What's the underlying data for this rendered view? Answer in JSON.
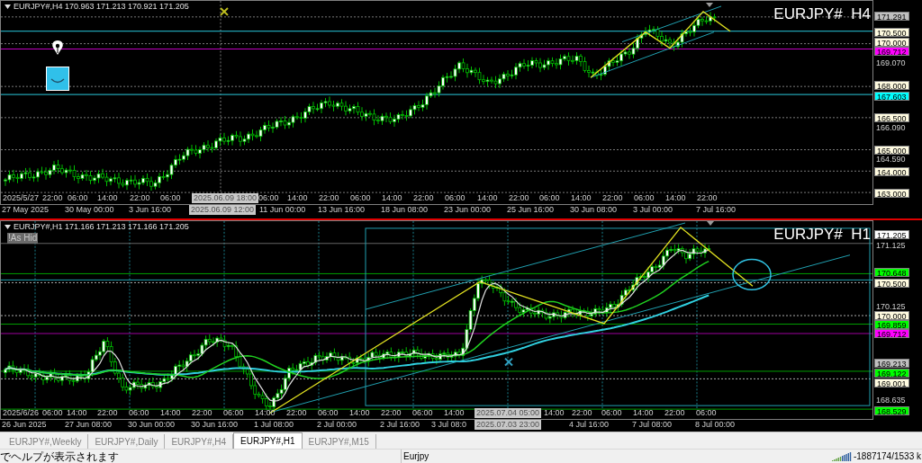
{
  "panels": [
    {
      "kind": "h4",
      "header": "EURJPY#,H4 170.963 171.213 170.921 171.205",
      "title": "EURJPY#  H4",
      "price_labels": [
        {
          "text": "171.291",
          "kind": "tag",
          "color": "#c0c0c0"
        },
        {
          "text": "170.500",
          "kind": "tag",
          "color": "#fffbe0"
        },
        {
          "text": "170.000",
          "kind": "tag",
          "color": "#fffbe0"
        },
        {
          "text": "169.712",
          "kind": "tag",
          "color": "#ff00ff"
        },
        {
          "text": "169.070",
          "kind": "plain"
        },
        {
          "text": "168.000",
          "kind": "tag",
          "color": "#fffbe0"
        },
        {
          "text": "167.603",
          "kind": "tag",
          "color": "#00ffff"
        },
        {
          "text": "166.500",
          "kind": "tag",
          "color": "#fffbe0"
        },
        {
          "text": "166.090",
          "kind": "plain"
        },
        {
          "text": "165.000",
          "kind": "tag",
          "color": "#fffbe0"
        },
        {
          "text": "164.590",
          "kind": "plain"
        },
        {
          "text": "164.000",
          "kind": "tag",
          "color": "#fffbe0"
        },
        {
          "text": "163.000",
          "kind": "tag",
          "color": "#fffbe0"
        }
      ],
      "time_row_1": [
        {
          "text": "2025/5/27",
          "highlighted": false
        },
        {
          "text": "22:00",
          "highlighted": false
        },
        {
          "text": "06:00",
          "highlighted": false
        },
        {
          "text": "14:00",
          "highlighted": false
        },
        {
          "text": "22:00",
          "highlighted": false
        },
        {
          "text": "06:00",
          "highlighted": false
        },
        {
          "text": "2025.06.09 18:00",
          "highlighted": true
        },
        {
          "text": "06:00",
          "highlighted": false
        },
        {
          "text": "14:00",
          "highlighted": false
        },
        {
          "text": "22:00",
          "highlighted": false
        },
        {
          "text": "06:00",
          "highlighted": false
        },
        {
          "text": "14:00",
          "highlighted": false
        },
        {
          "text": "22:00",
          "highlighted": false
        },
        {
          "text": "06:00",
          "highlighted": false
        },
        {
          "text": "14:00",
          "highlighted": false
        },
        {
          "text": "22:00",
          "highlighted": false
        },
        {
          "text": "06:00",
          "highlighted": false
        },
        {
          "text": "14:00",
          "highlighted": false
        },
        {
          "text": "22:00",
          "highlighted": false
        },
        {
          "text": "06:00",
          "highlighted": false
        },
        {
          "text": "14:00",
          "highlighted": false
        },
        {
          "text": "22:00",
          "highlighted": false
        }
      ],
      "time_row_2": [
        {
          "text": "27 May 2025",
          "highlighted": false
        },
        {
          "text": "30 May 00:00",
          "highlighted": false
        },
        {
          "text": "3 Jun 16:00",
          "highlighted": false
        },
        {
          "text": "2025.06.09 12:00",
          "highlighted": true
        },
        {
          "text": "11 Jun 00:00",
          "highlighted": false
        },
        {
          "text": "13 Jun 16:00",
          "highlighted": false
        },
        {
          "text": "18 Jun 08:00",
          "highlighted": false
        },
        {
          "text": "23 Jun 00:00",
          "highlighted": false
        },
        {
          "text": "25 Jun 16:00",
          "highlighted": false
        },
        {
          "text": "30 Jun 08:00",
          "highlighted": false
        },
        {
          "text": "3 Jul 00:00",
          "highlighted": false
        },
        {
          "text": "7 Jul 16:00",
          "highlighted": false
        }
      ]
    },
    {
      "kind": "h1",
      "header": "EURJPY#,H1 171.166 171.213 171.166 171.205",
      "title": "EURJPY#  H1",
      "badge": "!As Hid",
      "price_labels": [
        {
          "text": "171.205",
          "kind": "tag",
          "color": "#ffffff"
        },
        {
          "text": "171.125",
          "kind": "plain"
        },
        {
          "text": "170.648",
          "kind": "tag",
          "color": "#00ff00"
        },
        {
          "text": "170.500",
          "kind": "tag",
          "color": "#fffbe0"
        },
        {
          "text": "170.125",
          "kind": "plain"
        },
        {
          "text": "170.000",
          "kind": "tag",
          "color": "#fffbe0"
        },
        {
          "text": "169.859",
          "kind": "tag",
          "color": "#00ff00"
        },
        {
          "text": "169.712",
          "kind": "tag",
          "color": "#ff00ff"
        },
        {
          "text": "169.213",
          "kind": "tag",
          "color": "#c0c0c0"
        },
        {
          "text": "169.122",
          "kind": "tag",
          "color": "#00ff00"
        },
        {
          "text": "169.001",
          "kind": "tag",
          "color": "#fffbe0"
        },
        {
          "text": "168.635",
          "kind": "plain"
        },
        {
          "text": "168.529",
          "kind": "tag",
          "color": "#00ff00"
        }
      ],
      "time_row_1": [
        {
          "text": "2025/6/26",
          "highlighted": false
        },
        {
          "text": "06:00",
          "highlighted": false
        },
        {
          "text": "14:00",
          "highlighted": false
        },
        {
          "text": "22:00",
          "highlighted": false
        },
        {
          "text": "06:00",
          "highlighted": false
        },
        {
          "text": "14:00",
          "highlighted": false
        },
        {
          "text": "22:00",
          "highlighted": false
        },
        {
          "text": "06:00",
          "highlighted": false
        },
        {
          "text": "14:00",
          "highlighted": false
        },
        {
          "text": "22:00",
          "highlighted": false
        },
        {
          "text": "06:00",
          "highlighted": false
        },
        {
          "text": "14:00",
          "highlighted": false
        },
        {
          "text": "22:00",
          "highlighted": false
        },
        {
          "text": "06:00",
          "highlighted": false
        },
        {
          "text": "14:00",
          "highlighted": false
        },
        {
          "text": "2025.07.04 05:00",
          "highlighted": true
        },
        {
          "text": "14:00",
          "highlighted": false
        },
        {
          "text": "22:00",
          "highlighted": false
        },
        {
          "text": "06:00",
          "highlighted": false
        },
        {
          "text": "14:00",
          "highlighted": false
        },
        {
          "text": "22:00",
          "highlighted": false
        },
        {
          "text": "06:00",
          "highlighted": false
        }
      ],
      "time_row_2": [
        {
          "text": "26 Jun 2025",
          "highlighted": false
        },
        {
          "text": "27 Jun 08:00",
          "highlighted": false
        },
        {
          "text": "30 Jun 00:00",
          "highlighted": false
        },
        {
          "text": "30 Jun 16:00",
          "highlighted": false
        },
        {
          "text": "1 Jul 08:00",
          "highlighted": false
        },
        {
          "text": "2 Jul 00:00",
          "highlighted": false
        },
        {
          "text": "2 Jul 16:00",
          "highlighted": false
        },
        {
          "text": "3 Jul 08:0",
          "highlighted": false
        },
        {
          "text": "2025.07.03 23:00",
          "highlighted": true
        },
        {
          "text": "4 Jul 16:00",
          "highlighted": false
        },
        {
          "text": "7 Jul 08:00",
          "highlighted": false
        },
        {
          "text": "8 Jul 00:00",
          "highlighted": false
        }
      ]
    }
  ],
  "tabs": [
    {
      "label": "EURJPY#,Weekly",
      "selected": false
    },
    {
      "label": "EURJPY#,Daily",
      "selected": false
    },
    {
      "label": "EURJPY#,H4",
      "selected": false
    },
    {
      "label": "EURJPY#,H1",
      "selected": true
    },
    {
      "label": "EURJPY#,M15",
      "selected": false
    }
  ],
  "status_bar": {
    "help": "でヘルプが表示されます",
    "symbol": "Eurjpy",
    "traffic": "-1887174/1533 k"
  }
}
